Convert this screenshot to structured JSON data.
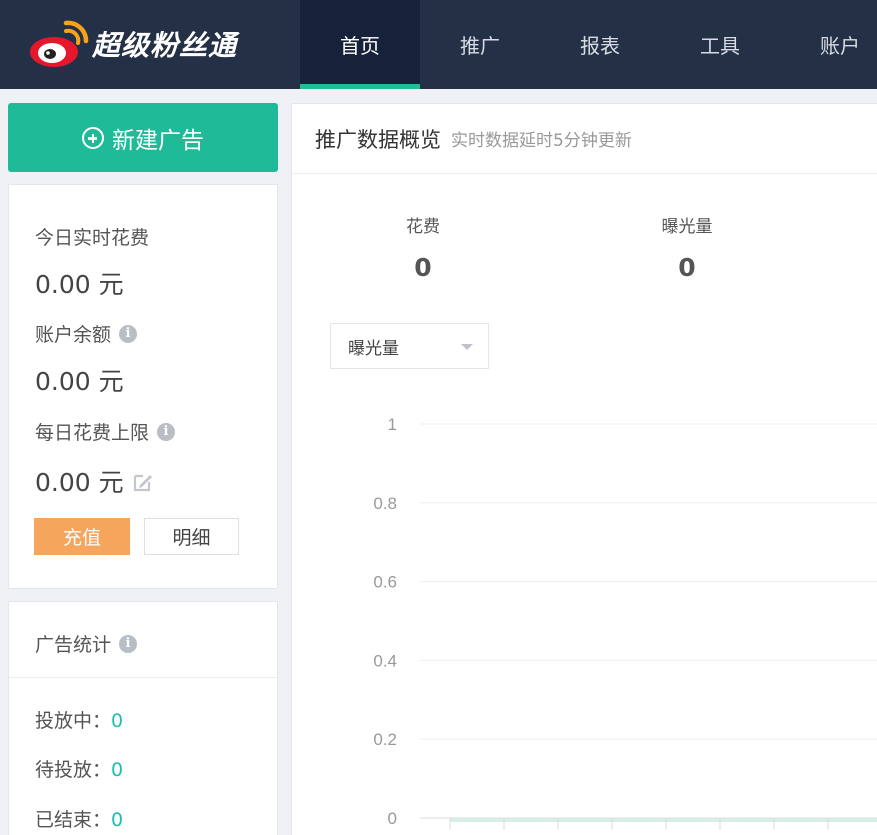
{
  "brand": {
    "name": "超级粉丝通",
    "logo_icon": "weibo-logo-icon"
  },
  "nav": {
    "items": [
      "首页",
      "推广",
      "报表",
      "工具",
      "账户"
    ],
    "active_index": 0
  },
  "new_ad": {
    "label": "新建广告",
    "icon": "plus-circle-icon"
  },
  "balance": {
    "today_spend_label": "今日实时花费",
    "today_spend_value": "0.00 元",
    "account_balance_label": "账户余额",
    "account_balance_value": "0.00 元",
    "daily_limit_label": "每日花费上限",
    "daily_limit_value": "0.00 元",
    "recharge_label": "充值",
    "detail_label": "明细"
  },
  "ad_stats": {
    "title": "广告统计",
    "rows": [
      {
        "label": "投放中：",
        "value": "0"
      },
      {
        "label": "待投放：",
        "value": "0"
      },
      {
        "label": "已结束：",
        "value": "0"
      }
    ]
  },
  "overview": {
    "title": "推广数据概览",
    "subtitle": "实时数据延时5分钟更新",
    "metrics": [
      {
        "label": "花费",
        "value": "0"
      },
      {
        "label": "曝光量",
        "value": "0"
      }
    ],
    "metric_select": "曝光量"
  },
  "colors": {
    "accent": "#1fbb98",
    "topbar": "#243045",
    "recharge": "#f5a55c",
    "stat_value": "#1dbfb0"
  },
  "chart_data": {
    "type": "line",
    "yticks": [
      "1",
      "0.8",
      "0.6",
      "0.4",
      "0.2",
      "0"
    ],
    "ylim": [
      0,
      1
    ],
    "grid": true
  }
}
